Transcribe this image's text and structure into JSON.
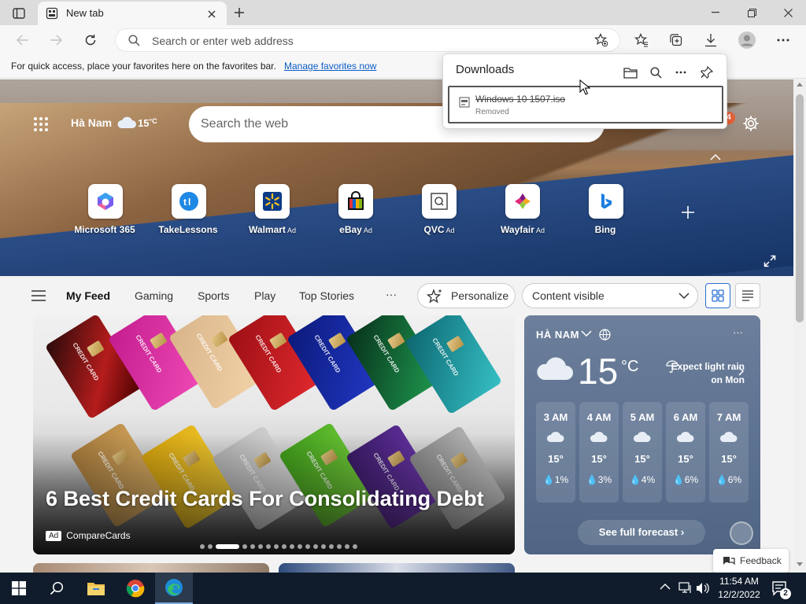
{
  "browser": {
    "tab_title": "New tab",
    "address_placeholder": "Search or enter web address"
  },
  "favorites_bar": {
    "text": "For quick access, place your favorites here on the favorites bar.",
    "link": "Manage favorites now"
  },
  "hero": {
    "location": "Hà Nam",
    "temperature": "15",
    "unit": "°C",
    "search_placeholder": "Search the web",
    "notification_count": "4",
    "quick_links": [
      {
        "label": "Microsoft 365",
        "ad": ""
      },
      {
        "label": "TakeLessons",
        "ad": ""
      },
      {
        "label": "Walmart",
        "ad": "Ad"
      },
      {
        "label": "eBay",
        "ad": "Ad"
      },
      {
        "label": "QVC",
        "ad": "Ad"
      },
      {
        "label": "Wayfair",
        "ad": "Ad"
      },
      {
        "label": "Bing",
        "ad": ""
      }
    ]
  },
  "feed_nav": {
    "items": [
      "My Feed",
      "Gaming",
      "Sports",
      "Play",
      "Top Stories"
    ],
    "more": "···",
    "personalize": "Personalize",
    "content_visibility": "Content visible"
  },
  "main_card": {
    "title": "6 Best Credit Cards For Consolidating Debt",
    "ad_badge": "Ad",
    "source": "CompareCards",
    "card_text": "CREDIT CARD",
    "carousel_count": 18,
    "carousel_active": 2
  },
  "weather": {
    "location": "HÀ NAM",
    "temperature": "15",
    "unit": "°C",
    "more": "···",
    "expect": "Expect light rain on Mon",
    "hours": [
      {
        "time": "3 AM",
        "temp": "15°",
        "precip": "1%"
      },
      {
        "time": "4 AM",
        "temp": "15°",
        "precip": "3%"
      },
      {
        "time": "5 AM",
        "temp": "15°",
        "precip": "4%"
      },
      {
        "time": "6 AM",
        "temp": "15°",
        "precip": "6%"
      },
      {
        "time": "7 AM",
        "temp": "15°",
        "precip": "6%"
      }
    ],
    "full_forecast": "See full forecast"
  },
  "feedback": "Feedback",
  "downloads": {
    "title": "Downloads",
    "file_name": "Windows 10 1507.iso",
    "status": "Removed"
  },
  "taskbar": {
    "time": "11:54 AM",
    "date": "12/2/2022",
    "notifications": "2"
  },
  "colors": {
    "link": "#0a5cc7",
    "taskbar": "#101c2c",
    "weather_card": "#5e7391"
  }
}
